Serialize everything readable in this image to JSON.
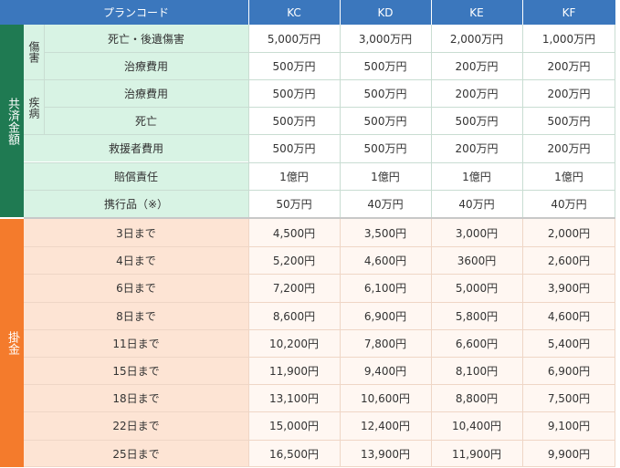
{
  "header": {
    "label": "プランコード",
    "plans": [
      "KC",
      "KD",
      "KE",
      "KF"
    ]
  },
  "sections": {
    "coverage_title": "共済金額",
    "premium_title": "掛金"
  },
  "coverage": {
    "injury_group": "傷害",
    "illness_group": "疾病",
    "rows": [
      {
        "label": "死亡・後遺傷害",
        "values": [
          "5,000万円",
          "3,000万円",
          "2,000万円",
          "1,000万円"
        ]
      },
      {
        "label": "治療費用",
        "values": [
          "500万円",
          "500万円",
          "200万円",
          "200万円"
        ]
      },
      {
        "label": "治療費用",
        "values": [
          "500万円",
          "500万円",
          "200万円",
          "200万円"
        ]
      },
      {
        "label": "死亡",
        "values": [
          "500万円",
          "500万円",
          "500万円",
          "500万円"
        ]
      },
      {
        "label": "救援者費用",
        "values": [
          "500万円",
          "500万円",
          "200万円",
          "200万円"
        ]
      },
      {
        "label": "賠償責任",
        "values": [
          "1億円",
          "1億円",
          "1億円",
          "1億円"
        ]
      },
      {
        "label": "携行品（※）",
        "values": [
          "50万円",
          "40万円",
          "40万円",
          "40万円"
        ]
      }
    ]
  },
  "premiums": {
    "rows": [
      {
        "label": "3日まで",
        "values": [
          "4,500円",
          "3,500円",
          "3,000円",
          "2,000円"
        ]
      },
      {
        "label": "4日まで",
        "values": [
          "5,200円",
          "4,600円",
          "3600円",
          "2,600円"
        ]
      },
      {
        "label": "6日まで",
        "values": [
          "7,200円",
          "6,100円",
          "5,000円",
          "3,900円"
        ]
      },
      {
        "label": "8日まで",
        "values": [
          "8,600円",
          "6,900円",
          "5,800円",
          "4,600円"
        ]
      },
      {
        "label": "11日まで",
        "values": [
          "10,200円",
          "7,800円",
          "6,600円",
          "5,400円"
        ]
      },
      {
        "label": "15日まで",
        "values": [
          "11,900円",
          "9,400円",
          "8,100円",
          "6,900円"
        ]
      },
      {
        "label": "18日まで",
        "values": [
          "13,100円",
          "10,600円",
          "8,800円",
          "7,500円"
        ]
      },
      {
        "label": "22日まで",
        "values": [
          "15,000円",
          "12,400円",
          "10,400円",
          "9,100円"
        ]
      },
      {
        "label": "25日まで",
        "values": [
          "16,500円",
          "13,900円",
          "11,900円",
          "9,900円"
        ]
      }
    ]
  }
}
